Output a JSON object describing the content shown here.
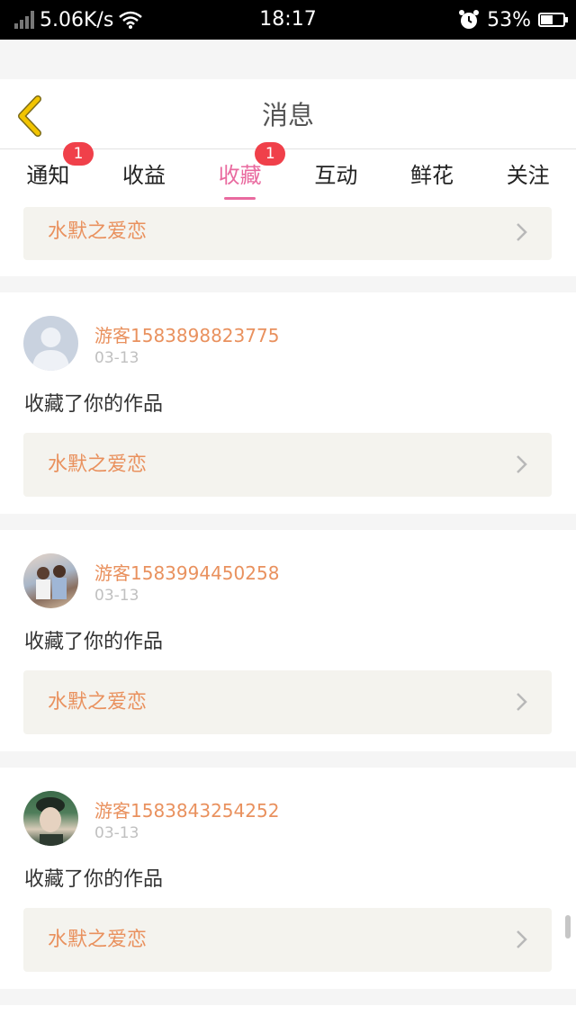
{
  "status_bar": {
    "net_speed": "5.06K/s",
    "time": "18:17",
    "battery": "53%",
    "battery_level": 0.53
  },
  "header": {
    "title": "消息",
    "back_icon": "chevron-left-icon"
  },
  "tabs": [
    {
      "label": "通知",
      "badge": "1",
      "active": false
    },
    {
      "label": "收益",
      "badge": "",
      "active": false
    },
    {
      "label": "收藏",
      "badge": "1",
      "active": true
    },
    {
      "label": "互动",
      "badge": "",
      "active": false
    },
    {
      "label": "鲜花",
      "badge": "",
      "active": false
    },
    {
      "label": "关注",
      "badge": "",
      "active": false
    }
  ],
  "colors": {
    "accent": "#e96a9f",
    "username": "#e9915e",
    "badge": "#f0404a",
    "back_icon": "#f2c400"
  },
  "partial_item": {
    "work_title": "水默之爱恋"
  },
  "items": [
    {
      "username": "游客1583898823775",
      "date": "03-13",
      "message": "收藏了你的作品",
      "work_title": "水默之爱恋",
      "avatar": "default-avatar"
    },
    {
      "username": "游客1583994450258",
      "date": "03-13",
      "message": "收藏了你的作品",
      "work_title": "水默之爱恋",
      "avatar": "photo-avatar"
    },
    {
      "username": "游客1583843254252",
      "date": "03-13",
      "message": "收藏了你的作品",
      "work_title": "水默之爱恋",
      "avatar": "photo-avatar"
    }
  ]
}
